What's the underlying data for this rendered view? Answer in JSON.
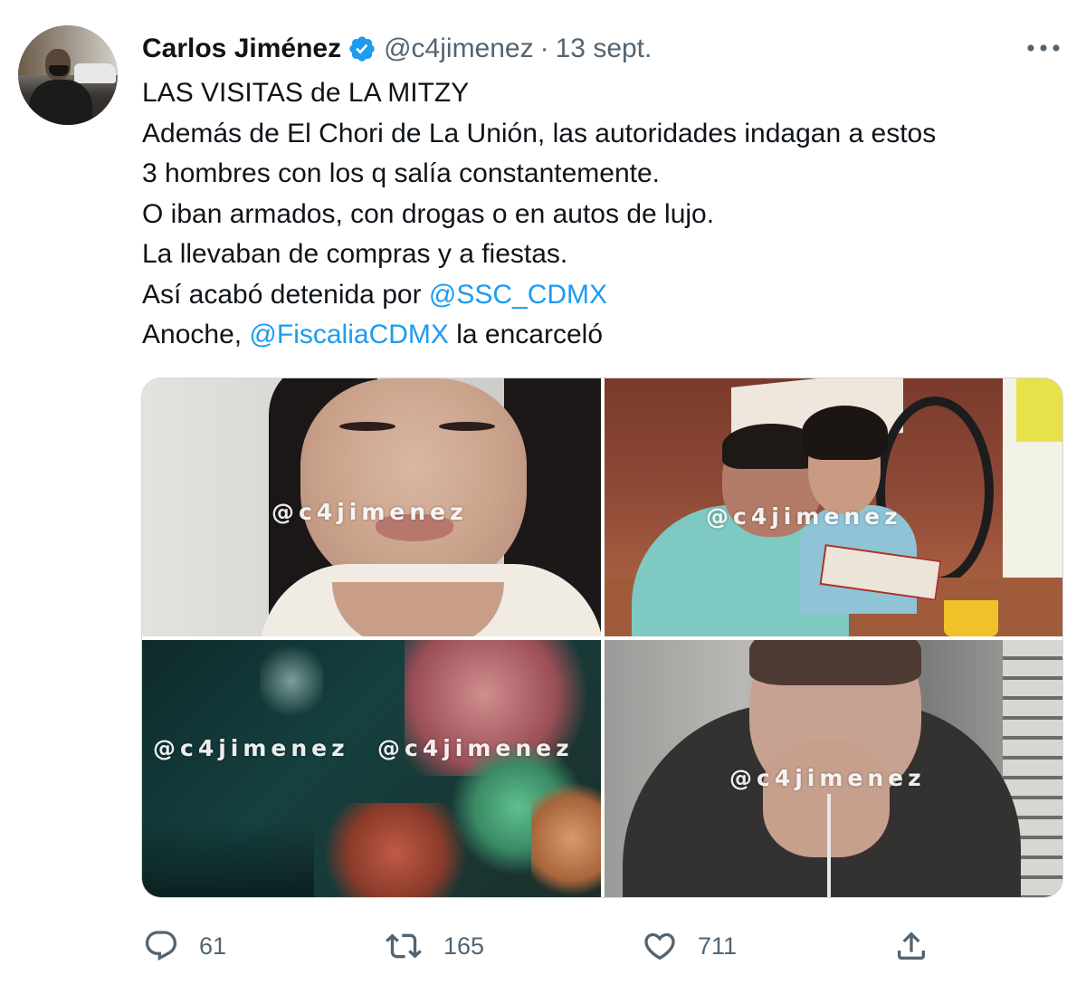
{
  "author": {
    "display_name": "Carlos Jiménez",
    "handle": "@c4jimenez",
    "separator": "·",
    "date": "13 sept.",
    "verified": true
  },
  "tweet": {
    "lines": [
      {
        "text": "LAS VISITAS de LA MITZY"
      },
      {
        "text": "Además de El Chori de La Unión, las autoridades indagan a estos"
      },
      {
        "text": "3 hombres con los q salía constantemente."
      },
      {
        "text": "O iban armados, con drogas o en autos de lujo."
      },
      {
        "text": "La llevaban de compras y a fiestas."
      },
      {
        "before": "Así acabó detenida por ",
        "mention": "@SSC_CDMX",
        "after": ""
      },
      {
        "before": "Anoche, ",
        "mention": "@FiscaliaCDMX",
        "after": " la encarceló"
      }
    ]
  },
  "media": {
    "photos": [
      {
        "watermarks": [
          "@c4jimenez"
        ]
      },
      {
        "watermarks": [
          "@c4jimenez"
        ]
      },
      {
        "watermarks": [
          "@c4jimenez",
          "@c4jimenez"
        ]
      },
      {
        "watermarks": [
          "@c4jimenez"
        ]
      }
    ]
  },
  "actions": {
    "reply_count": "61",
    "retweet_count": "165",
    "like_count": "711"
  },
  "colors": {
    "accent": "#1d9bf0",
    "text": "#0f1419",
    "secondary": "#536471"
  },
  "icons": [
    "verified-badge-icon",
    "more-options-icon",
    "reply-icon",
    "retweet-icon",
    "like-icon",
    "share-icon"
  ]
}
